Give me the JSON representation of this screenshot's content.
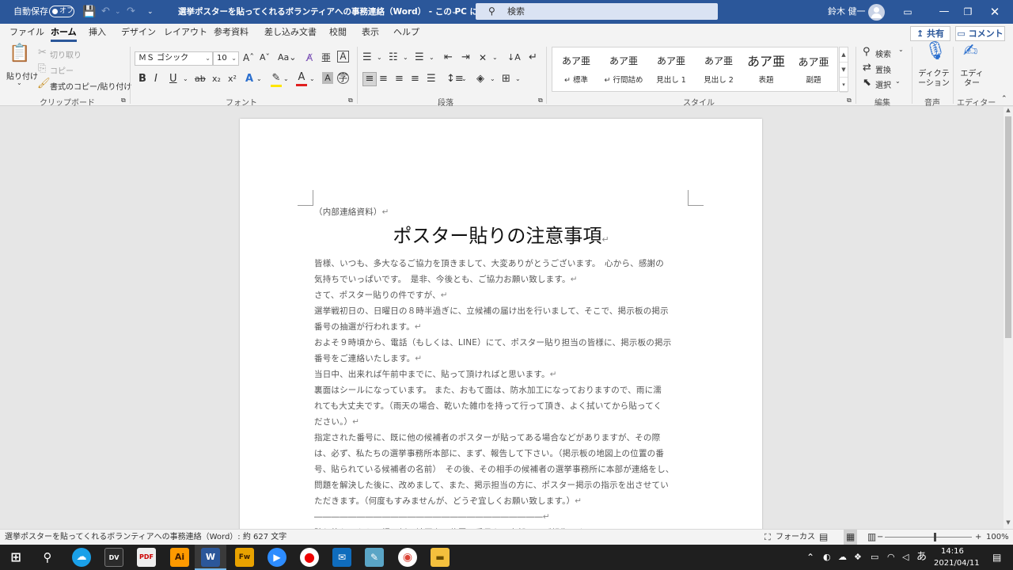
{
  "titlebar": {
    "autosave_label": "自動保存",
    "autosave_state": "オフ",
    "document_title": "選挙ポスターを貼ってくれるボランティアへの事務連絡（Word） - この PC に保存済み",
    "title_dropdown": "⌄",
    "search_placeholder": "検索",
    "user_name": "鈴木 健一",
    "customize_glyph": "⌄"
  },
  "tabs": [
    "ファイル",
    "ホーム",
    "挿入",
    "デザイン",
    "レイアウト",
    "参考資料",
    "差し込み文書",
    "校閲",
    "表示",
    "ヘルプ"
  ],
  "share_label": "共有",
  "comment_label": "コメント",
  "ribbon": {
    "clipboard": {
      "paste": "貼り付け",
      "cut": "切り取り",
      "copy": "コピー",
      "format_painter": "書式のコピー/貼り付け",
      "group": "クリップボード"
    },
    "font": {
      "font_name": "ＭＳ ゴシック",
      "font_size": "10",
      "group": "フォント"
    },
    "paragraph": {
      "group": "段落"
    },
    "styles": {
      "sample": "あア亜",
      "items": [
        "標準",
        "行間詰め",
        "見出し 1",
        "見出し 2",
        "表題",
        "副題"
      ],
      "group": "スタイル"
    },
    "editing": {
      "find": "検索",
      "replace": "置換",
      "select": "選択",
      "group": "編集"
    },
    "voice": {
      "dictate": "ディクテーション",
      "group": "音声"
    },
    "editor": {
      "label": "エディター",
      "group": "エディター"
    }
  },
  "document": {
    "header_note": "（内部連絡資料）",
    "title": "ポスター貼りの注意事項",
    "paragraph_mark": "↵",
    "lines": [
      " 皆様、いつも、多大なるご協力を頂きまして、大変ありがとうございます。　心から、感謝の",
      "気持ちでいっぱいです。　是非、今後とも、ご協力お願い致します。",
      " さて、ポスター貼りの件ですが、",
      " 選挙戦初日の、日曜日の８時半過ぎに、立候補の届け出を行いまして、そこで、掲示板の掲示",
      "番号の抽選が行われます。",
      " およそ９時頃から、電話（もしくは、LINE）にて、ポスター貼り担当の皆様に、掲示板の掲示",
      "番号をご連絡いたします。",
      " 当日中、出来れば午前中までに、貼って頂ければと思います。",
      " 裏面はシールになっています。 また、おもて面は、防水加工になっておりますので、雨に濡",
      "れても大丈夫です。（雨天の場合、乾いた雑巾を持って行って頂き、よく拭いてから貼ってく",
      "ださい。）",
      " 指定された番号に、既に他の候補者のポスターが貼ってある場合などがありますが、その際",
      "は、必ず、私たちの選挙事務所本部に、まず、報告して下さい。（掲示板の地図上の位置の番",
      "号、貼られている候補者の名前）　その後、その相手の候補者の選挙事務所に本部が連絡をし、",
      "問題を解決した後に、改めまして、また、掲示担当の方に、ポスター掲示の指示を出させてい",
      "ただきます。（何度もすみませんが、どうぞ宜しくお願い致します。）",
      "―――――――――――――――――――――――――――",
      "貼り終わったら、掲示板の地図上の位置の番号を、本部までご報告下さい。"
    ],
    "line_breaks": [
      false,
      true,
      true,
      false,
      true,
      false,
      true,
      true,
      false,
      false,
      true,
      false,
      false,
      false,
      false,
      true,
      true,
      true
    ]
  },
  "statusbar": {
    "word_count": "選挙ポスターを貼ってくれるボランティアへの事務連絡（Word）: 約 627 文字",
    "focus": "フォーカス",
    "zoom": "100%"
  },
  "taskbar": {
    "apps": [
      "Dropbox",
      "DaVinci",
      "PDF",
      "Ai",
      "W",
      "Fw",
      "Zoom",
      "Rec",
      "Edge",
      "Notepad",
      "Chrome",
      "Explorer"
    ],
    "ime": "あ",
    "time": "14:16",
    "date": "2021/04/11"
  },
  "colors": {
    "title_bar": "#2b579a",
    "ribbon_bg": "#f3f3f3",
    "taskbar": "#1f1f1f"
  }
}
